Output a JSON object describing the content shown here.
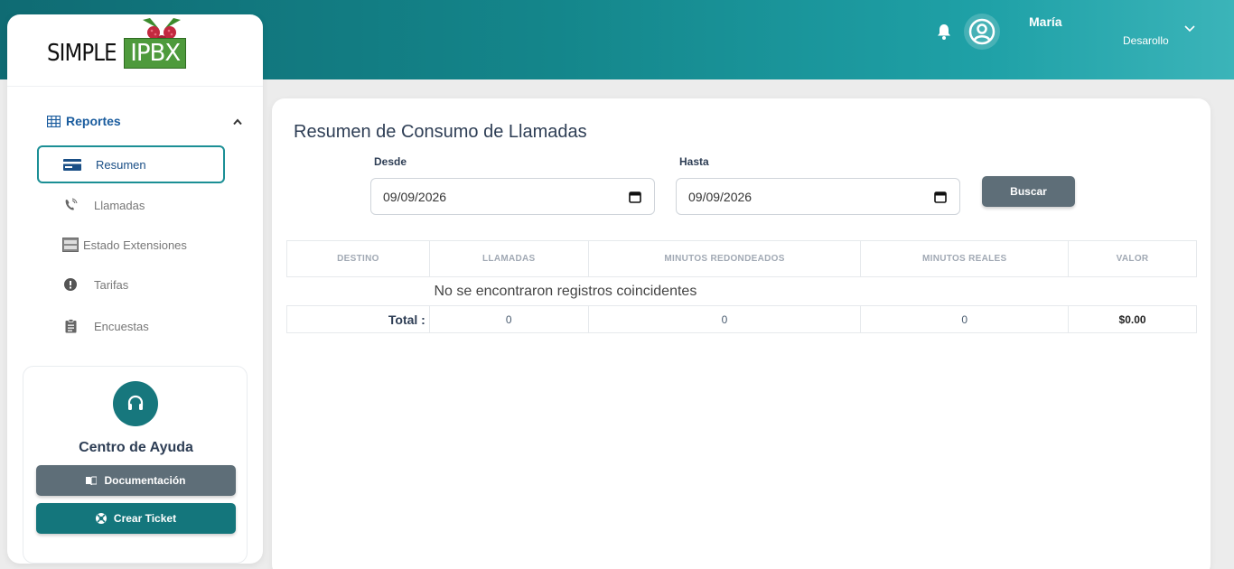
{
  "header": {
    "user_name": "María",
    "user_role": "Desarollo"
  },
  "sidebar": {
    "logo_simple": "SIMPLE",
    "logo_ipbx": "IPBX",
    "section_label": "Reportes",
    "items": [
      {
        "label": "Resumen",
        "icon": "credit-card-icon",
        "active": true
      },
      {
        "label": "Llamadas",
        "icon": "phone-icon",
        "active": false
      },
      {
        "label": "Estado Extensiones",
        "icon": "server-icon",
        "active": false
      },
      {
        "label": "Tarifas",
        "icon": "alert-circle-icon",
        "active": false
      },
      {
        "label": "Encuestas",
        "icon": "clipboard-icon",
        "active": false
      }
    ],
    "help": {
      "title": "Centro de Ayuda",
      "doc_button": "Documentación",
      "ticket_button": "Crear Ticket"
    }
  },
  "main": {
    "title": "Resumen de Consumo de Llamadas",
    "desde_label": "Desde",
    "desde_value": "09/09/2026",
    "hasta_label": "Hasta",
    "hasta_value": "09/09/2026",
    "search_button": "Buscar",
    "table": {
      "headers": [
        "DESTINO",
        "LLAMADAS",
        "MINUTOS REDONDEADOS",
        "MINUTOS REALES",
        "VALOR"
      ],
      "empty_message": "No se encontraron registros coincidentes",
      "total_label": "Total :",
      "totals": [
        "0",
        "0",
        "0",
        "$0.00"
      ]
    }
  },
  "colors": {
    "accent": "#14767c",
    "header_gradient_start": "#0f6b73",
    "header_gradient_end": "#3bb4b9",
    "button_gray": "#5e6e78"
  }
}
